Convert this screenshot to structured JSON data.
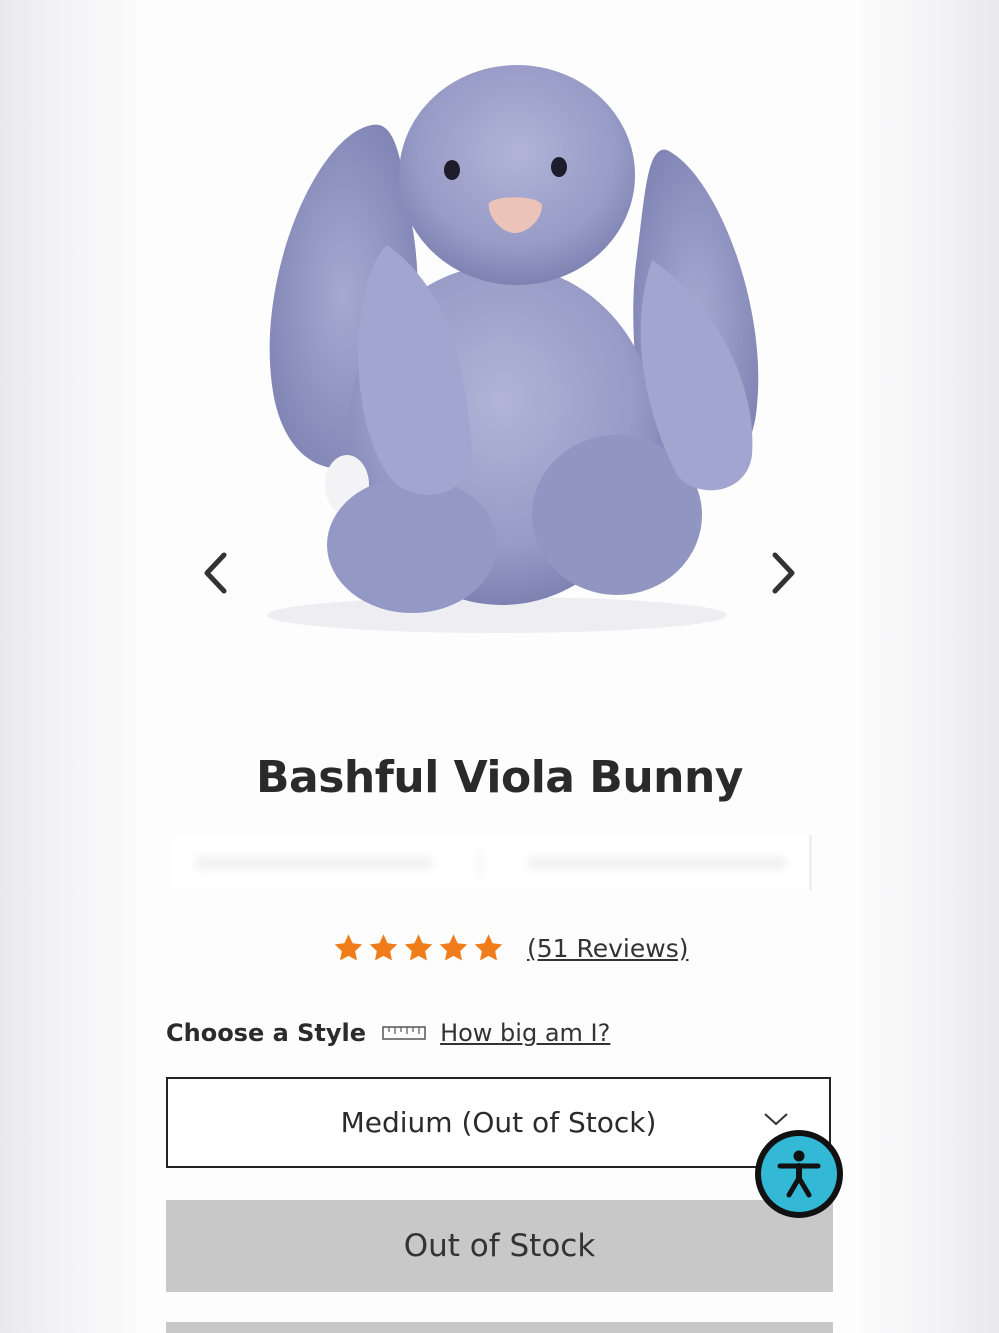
{
  "product": {
    "title": "Bashful Viola Bunny",
    "rating_stars": 5,
    "reviews_link": "(51 Reviews)"
  },
  "style_selector": {
    "label": "Choose a Style",
    "size_guide_link": "How big am I?",
    "selected_value": "Medium (Out of Stock)"
  },
  "actions": {
    "primary_button": "Out of Stock"
  },
  "icons": {
    "previous": "chevron-left-icon",
    "next": "chevron-right-icon",
    "ruler": "ruler-icon",
    "dropdown": "chevron-down-icon",
    "accessibility": "accessibility-icon",
    "star": "star-icon"
  },
  "colors": {
    "star": "#f07d1a",
    "button_disabled": "#c8c8c8",
    "accessibility_badge": "#33b8d6",
    "bunny_fur": "#9a9ec9"
  }
}
